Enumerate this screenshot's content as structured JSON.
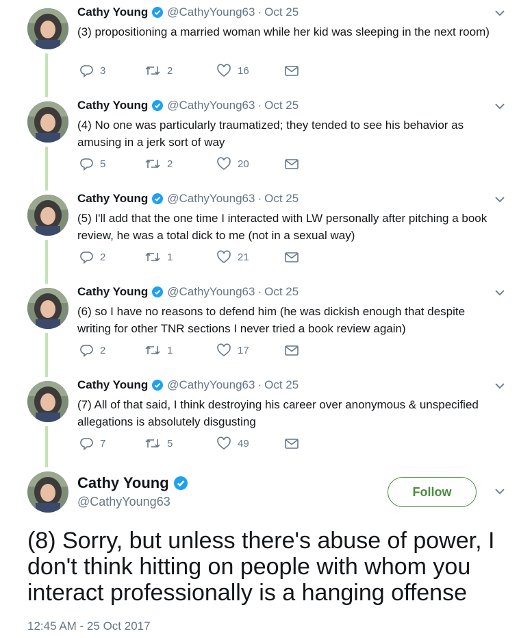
{
  "colors": {
    "accent": "#4a8c3d",
    "verified": "#1da1f2",
    "thread_line": "#c4e3b4",
    "muted": "#657786"
  },
  "icons": {
    "reply": "reply-icon",
    "retweet": "retweet-icon",
    "like": "heart-icon",
    "dm": "mail-icon",
    "verified": "verified-badge-icon",
    "more": "chevron-down-icon"
  },
  "tweets": [
    {
      "name": "Cathy Young",
      "handle": "@CathyYoung63",
      "sep": "·",
      "date": "Oct 25",
      "text": "(3) propositioning a married woman while her kid was sleeping in the next room)",
      "replies": "3",
      "retweets": "2",
      "likes": "16"
    },
    {
      "name": "Cathy Young",
      "handle": "@CathyYoung63",
      "sep": "·",
      "date": "Oct 25",
      "text": "(4) No one was particularly traumatized; they tended to see his behavior as amusing in a jerk sort of way",
      "replies": "5",
      "retweets": "2",
      "likes": "20"
    },
    {
      "name": "Cathy Young",
      "handle": "@CathyYoung63",
      "sep": "·",
      "date": "Oct 25",
      "text": "(5) I'll add that the one time I interacted with LW personally after pitching a book review, he was a total dick to me (not in a sexual way)",
      "replies": "2",
      "retweets": "1",
      "likes": "21"
    },
    {
      "name": "Cathy Young",
      "handle": "@CathyYoung63",
      "sep": "·",
      "date": "Oct 25",
      "text": "(6) so I have no reasons to defend him (he was dickish enough that despite writing for other TNR sections I never tried a book review again)",
      "replies": "2",
      "retweets": "1",
      "likes": "17"
    },
    {
      "name": "Cathy Young",
      "handle": "@CathyYoung63",
      "sep": "·",
      "date": "Oct 25",
      "text": "(7) All of that said, I think destroying his career over anonymous & unspecified allegations is absolutely disgusting",
      "replies": "7",
      "retweets": "5",
      "likes": "49"
    }
  ],
  "main": {
    "name": "Cathy Young",
    "handle": "@CathyYoung63",
    "follow_label": "Follow",
    "text": "(8) Sorry, but unless there's abuse of power, I don't think hitting on people with whom you interact professionally is a hanging offense",
    "timestamp": "12:45 AM - 25 Oct 2017"
  }
}
